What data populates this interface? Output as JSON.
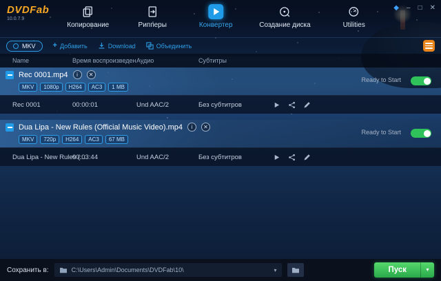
{
  "app": {
    "name": "DVDFab",
    "version": "10.0.7.9"
  },
  "window": {
    "gem": "◆",
    "minimize": "–",
    "maximize": "□",
    "close": "✕"
  },
  "nav": {
    "tabs": [
      {
        "label": "Копирование",
        "icon": "copy-icon",
        "active": false
      },
      {
        "label": "Рипперы",
        "icon": "ripper-icon",
        "active": false
      },
      {
        "label": "Конвертер",
        "icon": "converter-play-icon",
        "active": true
      },
      {
        "label": "Создание диска",
        "icon": "disc-burn-icon",
        "active": false
      },
      {
        "label": "Utilities",
        "icon": "utilities-icon",
        "active": false
      }
    ]
  },
  "toolbar": {
    "profile": "MKV",
    "add_plus": "+",
    "add_label": "Добавить",
    "download_label": "Download",
    "merge_label": "Объединить"
  },
  "table": {
    "headers": {
      "name": "Name",
      "time": "Время воспроизведен",
      "audio": "Аудио",
      "subtitles": "Субтитры"
    }
  },
  "items": [
    {
      "title": "Rec 0001.mp4",
      "info_glyph": "i",
      "close_glyph": "✕",
      "badges": [
        "MKV",
        "1080p",
        "H264",
        "AC3",
        "1 MB"
      ],
      "status": "Ready to Start",
      "enabled": true,
      "tracks": [
        {
          "name": "Rec 0001",
          "duration": "00:00:01",
          "audio": "Und  AAC/2",
          "subtitles": "Без субтитров"
        }
      ]
    },
    {
      "title": "Dua Lipa - New Rules (Official Music Video).mp4",
      "info_glyph": "i",
      "close_glyph": "✕",
      "badges": [
        "MKV",
        "720p",
        "H264",
        "AC3",
        "67 MB"
      ],
      "status": "Ready to Start",
      "enabled": true,
      "tracks": [
        {
          "name": "Dua Lipa - New Rules (...",
          "duration": "00:03:44",
          "audio": "Und  AAC/2",
          "subtitles": "Без субтитров"
        }
      ]
    }
  ],
  "footer": {
    "save_label": "Сохранить в:",
    "path": "C:\\Users\\Admin\\Documents\\DVDFab\\10\\",
    "path_caret": "▾",
    "start_label": "Пуск",
    "start_caret": "▾"
  },
  "colors": {
    "accent": "#2e9fe6",
    "toggle_green": "#2fc25b",
    "start_green": "#2aa94b",
    "queue_orange": "#e8841a",
    "logo_orange": "#f5a623"
  }
}
